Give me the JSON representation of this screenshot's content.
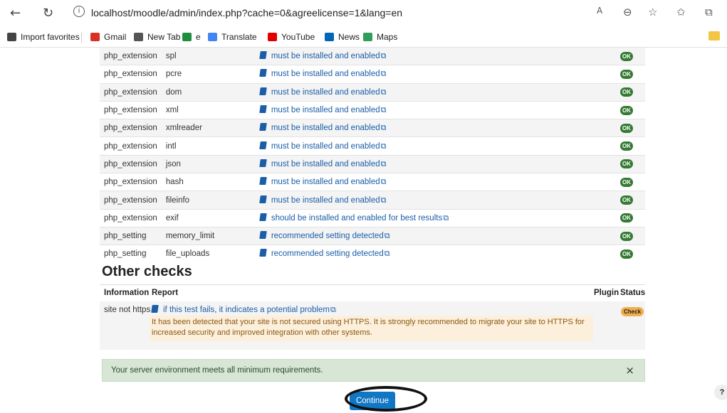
{
  "browser": {
    "url": "localhost/moodle/admin/index.php?cache=0&agreelicense=1&lang=en",
    "bookmarks": [
      {
        "label": "Import favorites",
        "color": "#444444"
      },
      {
        "label": "Gmail",
        "color": "#d93025"
      },
      {
        "label": "New Tab",
        "color": "#555555"
      },
      {
        "label": "e",
        "color": "#1e8e3e"
      },
      {
        "label": "Translate",
        "color": "#4285f4"
      },
      {
        "label": "YouTube",
        "color": "#e00000"
      },
      {
        "label": "News",
        "color": "#0067b8"
      },
      {
        "label": "Maps",
        "color": "#2e9e5a"
      }
    ]
  },
  "env_rows": [
    {
      "name": "php_extension",
      "info": "spl",
      "report": "must be installed and enabled",
      "status": "OK"
    },
    {
      "name": "php_extension",
      "info": "pcre",
      "report": "must be installed and enabled",
      "status": "OK"
    },
    {
      "name": "php_extension",
      "info": "dom",
      "report": "must be installed and enabled",
      "status": "OK"
    },
    {
      "name": "php_extension",
      "info": "xml",
      "report": "must be installed and enabled",
      "status": "OK"
    },
    {
      "name": "php_extension",
      "info": "xmlreader",
      "report": "must be installed and enabled",
      "status": "OK"
    },
    {
      "name": "php_extension",
      "info": "intl",
      "report": "must be installed and enabled",
      "status": "OK"
    },
    {
      "name": "php_extension",
      "info": "json",
      "report": "must be installed and enabled",
      "status": "OK"
    },
    {
      "name": "php_extension",
      "info": "hash",
      "report": "must be installed and enabled",
      "status": "OK"
    },
    {
      "name": "php_extension",
      "info": "fileinfo",
      "report": "must be installed and enabled",
      "status": "OK"
    },
    {
      "name": "php_extension",
      "info": "exif",
      "report": "should be installed and enabled for best results",
      "status": "OK"
    },
    {
      "name": "php_setting",
      "info": "memory_limit",
      "report": "recommended setting detected",
      "status": "OK"
    },
    {
      "name": "php_setting",
      "info": "file_uploads",
      "report": "recommended setting detected",
      "status": "OK"
    }
  ],
  "other_checks": {
    "title": "Other checks",
    "headers": {
      "information": "Information",
      "report": "Report",
      "plugin": "Plugin",
      "status": "Status"
    },
    "row": {
      "info": "site not https",
      "report": "if this test fails, it indicates a potential problem",
      "warning": "It has been detected that your site is not secured using HTTPS. It is strongly recommended to migrate your site to HTTPS for increased security and improved integration with other systems.",
      "status": "Check"
    }
  },
  "success_message": "Your server environment meets all minimum requirements.",
  "close_symbol": "×",
  "continue_label": "Continue",
  "help_label": "?"
}
